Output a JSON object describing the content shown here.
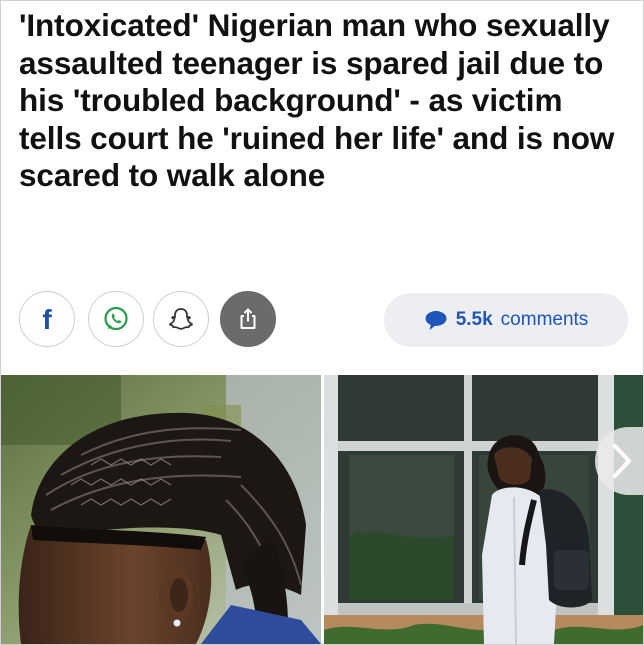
{
  "article": {
    "headline": "'Intoxicated' Nigerian man who sexually assaulted teenager is spared jail due to his 'troubled background' - as victim tells court he 'ruined her life' and is now scared to walk alone"
  },
  "share": {
    "buttons": [
      {
        "icon": "facebook-icon",
        "glyph": "f"
      },
      {
        "icon": "whatsapp-icon"
      },
      {
        "icon": "snapchat-icon"
      },
      {
        "icon": "share-icon"
      }
    ]
  },
  "comments": {
    "count": "5.5k",
    "label": "comments",
    "icon": "speech-bubble-icon"
  },
  "gallery": {
    "next_icon": "chevron-right-icon"
  },
  "colors": {
    "headline": "#111111",
    "facebook": "#1d4fa5",
    "comments_accent": "#1f54b8",
    "comments_pill_bg": "#eceef1",
    "share_button_dark": "#6b6b6b"
  }
}
